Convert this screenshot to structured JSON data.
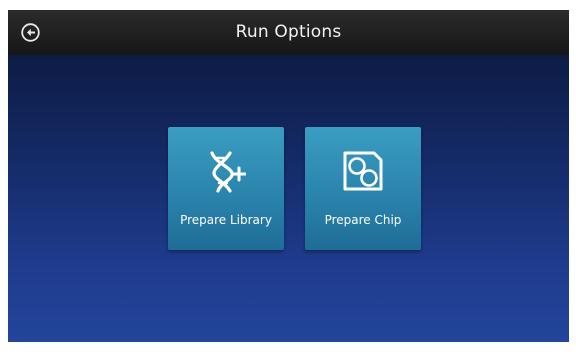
{
  "header": {
    "title": "Run Options",
    "back_icon": "back-arrow-circle-icon"
  },
  "tiles": [
    {
      "label": "Prepare Library",
      "icon": "dna-plus-icon"
    },
    {
      "label": "Prepare Chip",
      "icon": "chip-icon"
    }
  ],
  "colors": {
    "header_bg": "#1f1f1f",
    "background_top": "#0d1c45",
    "background_bottom": "#23449b",
    "tile_bg": "#2a84ad",
    "text": "#ffffff"
  }
}
